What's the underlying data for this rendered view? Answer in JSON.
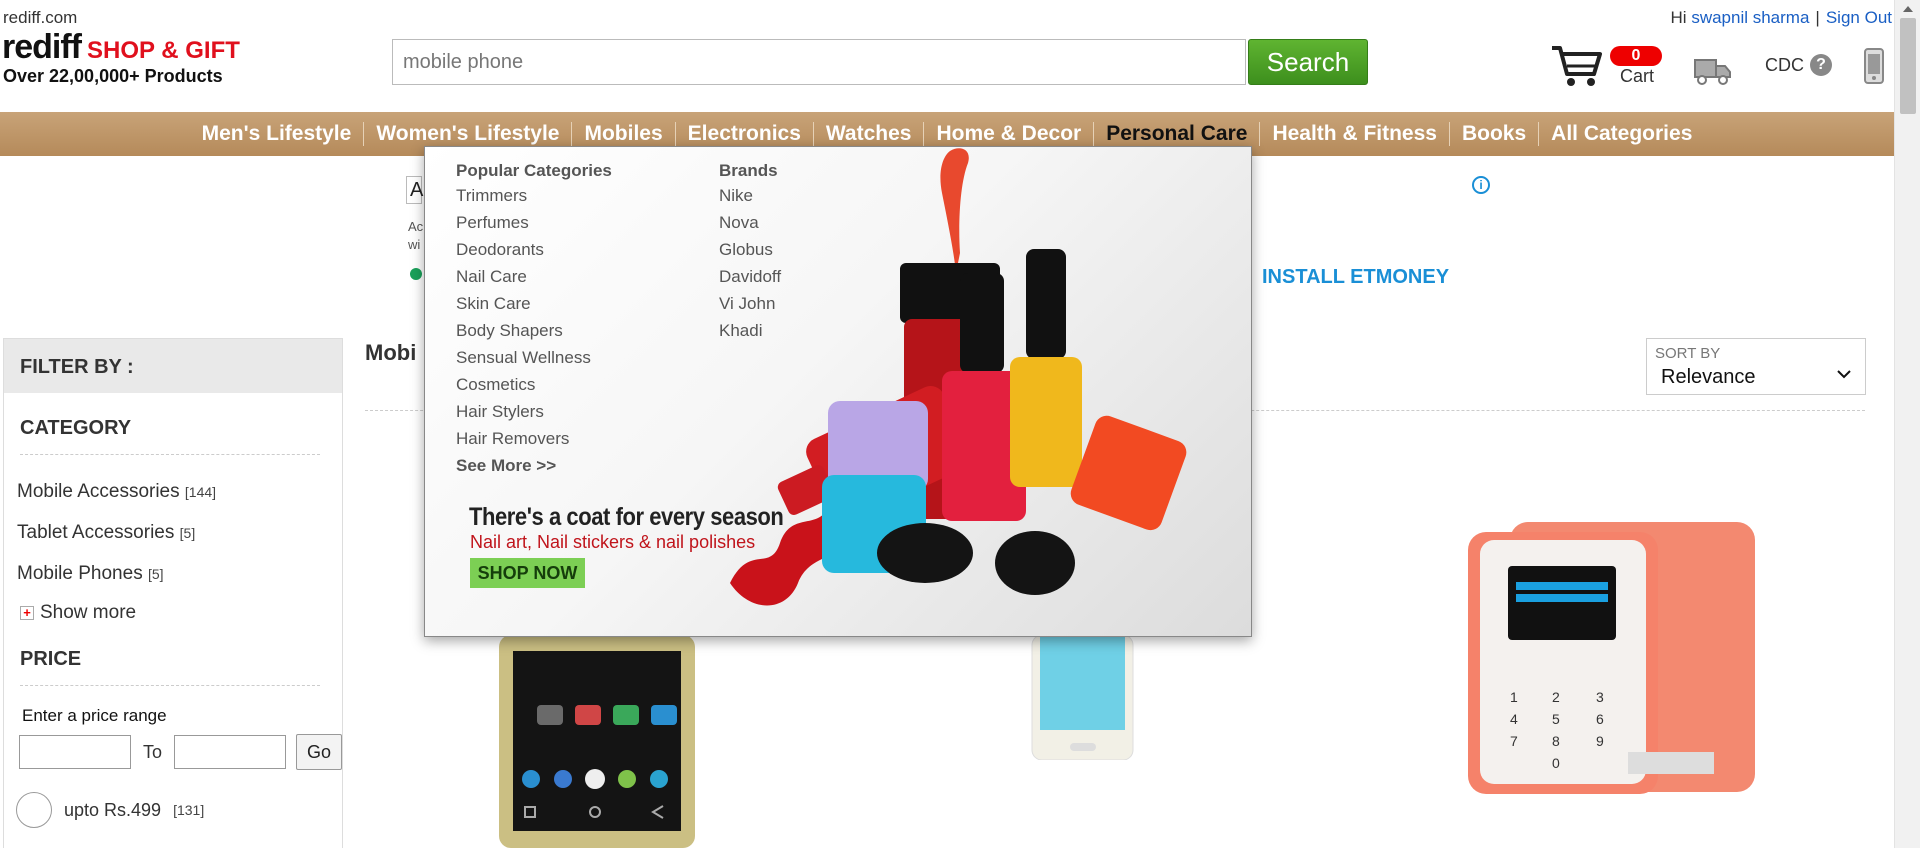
{
  "header": {
    "site_url": "rediff.com",
    "logo_word": "rediff",
    "logo_tag": "SHOP & GIFT",
    "tagline": "Over 22,00,000+ Products",
    "search_placeholder": "mobile phone",
    "search_button": "Search",
    "greeting_prefix": "Hi",
    "user_name": "swapnil sharma",
    "separator": "|",
    "sign_out": "Sign Out",
    "cart_count": "0",
    "cart_label": "Cart",
    "cdc_label": "CDC",
    "cdc_help": "?"
  },
  "nav": {
    "items": [
      "Men's Lifestyle",
      "Women's Lifestyle",
      "Mobiles",
      "Electronics",
      "Watches",
      "Home & Decor",
      "Personal Care",
      "Health & Fitness",
      "Books",
      "All Categories"
    ],
    "active": "Personal Care"
  },
  "ad": {
    "box_text": "A",
    "frag_text": "Ac\nwi",
    "cta": "INSTALL ETMONEY",
    "info": "i"
  },
  "dropdown": {
    "popular_heading": "Popular Categories",
    "popular": [
      "Trimmers",
      "Perfumes",
      "Deodorants",
      "Nail Care",
      "Skin Care",
      "Body Shapers",
      "Sensual Wellness",
      "Cosmetics",
      "Hair Stylers",
      "Hair Removers"
    ],
    "see_more": "See More >>",
    "brands_heading": "Brands",
    "brands": [
      "Nike",
      "Nova",
      "Globus",
      "Davidoff",
      "Vi John",
      "Khadi"
    ],
    "promo_heading": "There's a coat for every season",
    "promo_sub": "Nail art, Nail stickers & nail polishes",
    "promo_button": "SHOP NOW"
  },
  "sidebar": {
    "filter_heading": "FILTER BY :",
    "category_heading": "CATEGORY",
    "categories": [
      {
        "name": "Mobile Accessories",
        "count": "[144]"
      },
      {
        "name": "Tablet Accessories",
        "count": "[5]"
      },
      {
        "name": "Mobile Phones",
        "count": "[5]"
      }
    ],
    "show_more": "Show more",
    "price_heading": "PRICE",
    "price_range_label": "Enter a price range",
    "to_label": "To",
    "go_label": "Go",
    "price_options": [
      {
        "label": "upto Rs.499",
        "count": "[131]"
      }
    ]
  },
  "main": {
    "results_title": "Mobi",
    "sort_label": "SORT BY",
    "sort_value": "Relevance"
  },
  "colors": {
    "nav_bg": "#b58a5a",
    "search_btn": "#4a9e25",
    "brand_red": "#e0101d",
    "link_blue": "#1a5fc4",
    "promo_green": "#7ccf54"
  }
}
